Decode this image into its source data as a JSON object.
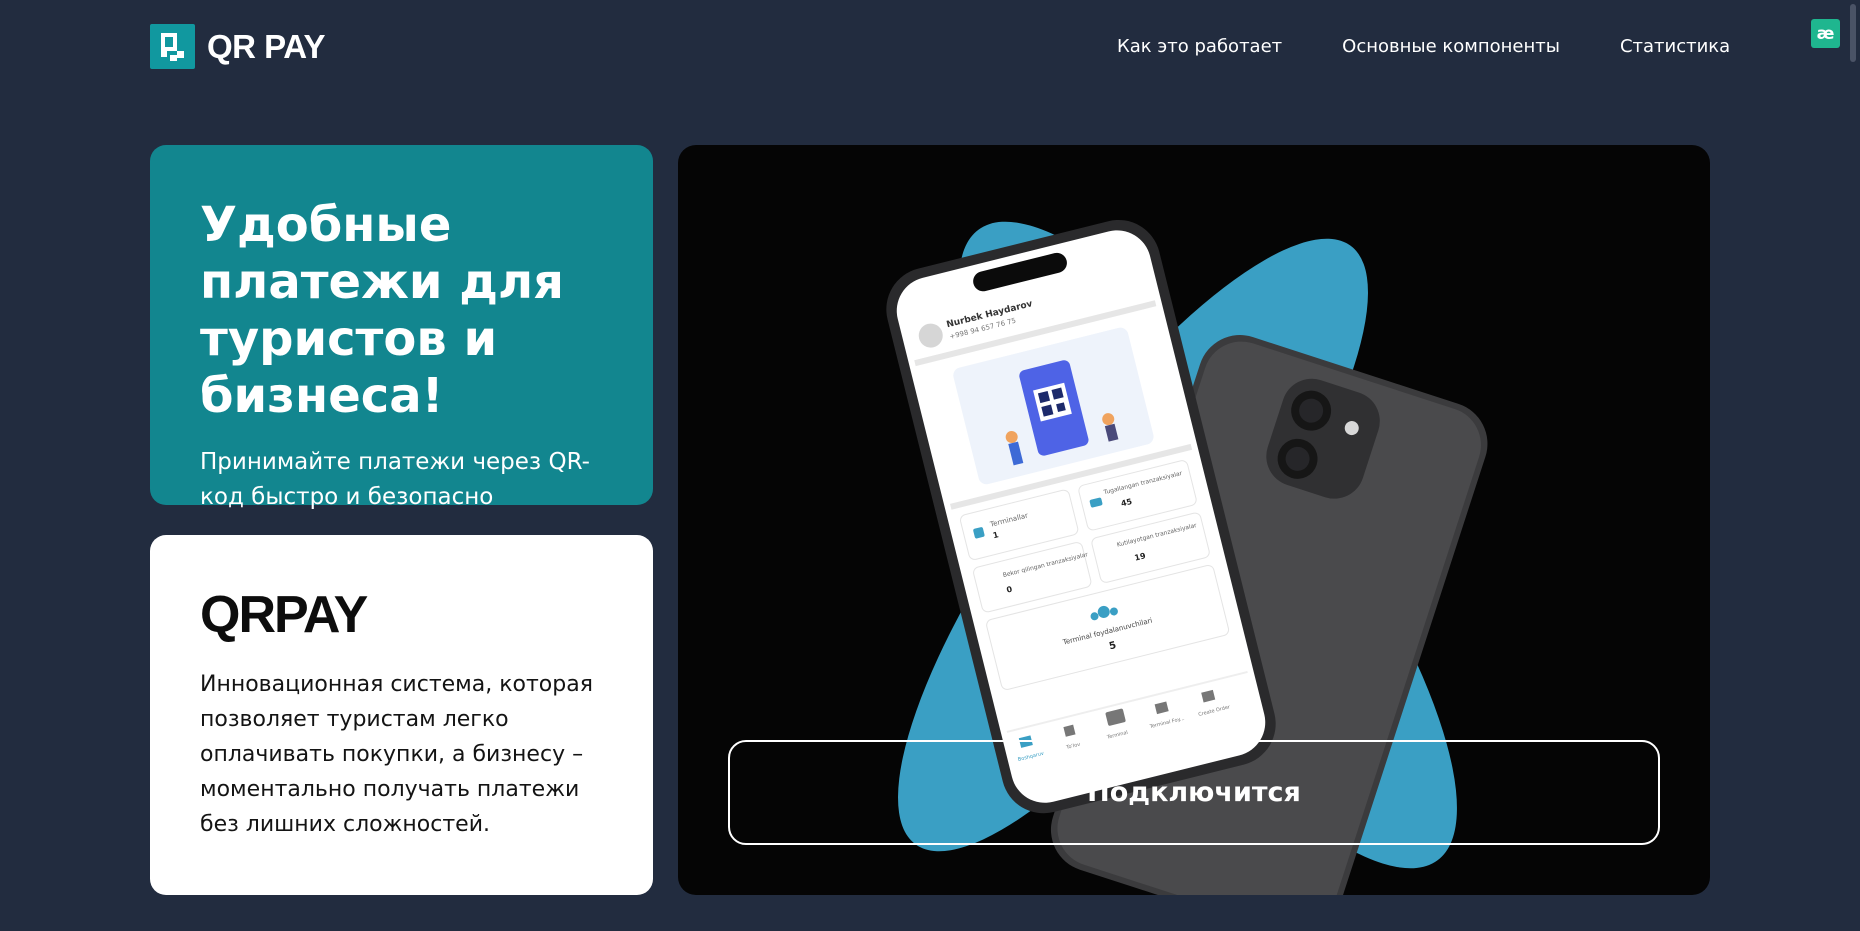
{
  "header": {
    "logo_text": "QR PAY",
    "nav": [
      {
        "label": "Как это работает"
      },
      {
        "label": "Основные компоненты"
      },
      {
        "label": "Статистика"
      }
    ],
    "extension_icon_text": "æ"
  },
  "hero": {
    "title": "Удобные платежи для туристов и бизнеса!",
    "subtitle": "Принимайте платежи через QR-код быстро и безопасно"
  },
  "info": {
    "brand": "QRPAY",
    "description": "Инновационная система, которая позволяет туристам легко оплачивать покупки, а бизнесу – моментально получать платежи без лишних сложностей."
  },
  "showcase": {
    "connect_label": "Подключится",
    "phone_screen": {
      "user_name": "Nurbek Haydarov",
      "user_phone": "+998 94 657 76 75",
      "cards": [
        {
          "label": "Terminallar",
          "value": "1"
        },
        {
          "label": "Tugallangan tranzaksiyalar",
          "value": "45"
        },
        {
          "label": "Bekor qilingan tranzaksiyalar",
          "value": "0"
        },
        {
          "label": "Kutilayotgan tranzaksiyalar",
          "value": "19"
        },
        {
          "label": "Terminal foydalanuvchilari",
          "value": "5"
        }
      ],
      "tabs": [
        "Boshqaruv",
        "To'lov",
        "Terminal",
        "Terminal Foy...",
        "Create Order"
      ]
    }
  },
  "colors": {
    "page_bg": "#222c3f",
    "teal": "#12868f",
    "accent_blue": "#3a9fc4",
    "showcase_bg": "#050505"
  }
}
